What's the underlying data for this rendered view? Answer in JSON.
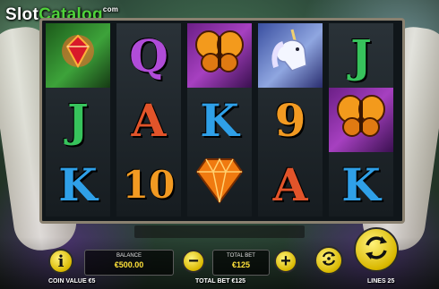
{
  "logo": {
    "part1": "Slot",
    "part2": "Catalog",
    "suffix": "com"
  },
  "reels": [
    [
      {
        "symbol": "",
        "kind": "wild",
        "icon": "red-gem-flower-icon"
      },
      {
        "symbol": "J",
        "kind": "letter",
        "color": "green"
      },
      {
        "symbol": "K",
        "kind": "letter",
        "color": "blue"
      }
    ],
    [
      {
        "symbol": "Q",
        "kind": "letter",
        "color": "purple"
      },
      {
        "symbol": "A",
        "kind": "letter",
        "color": "red"
      },
      {
        "symbol": "10",
        "kind": "letter",
        "color": "orange"
      }
    ],
    [
      {
        "symbol": "",
        "kind": "picture",
        "icon": "butterfly-icon"
      },
      {
        "symbol": "K",
        "kind": "letter",
        "color": "blue"
      },
      {
        "symbol": "",
        "kind": "picture",
        "icon": "orange-diamond-icon"
      }
    ],
    [
      {
        "symbol": "",
        "kind": "picture",
        "icon": "unicorn-icon"
      },
      {
        "symbol": "9",
        "kind": "letter",
        "color": "orange"
      },
      {
        "symbol": "A",
        "kind": "letter",
        "color": "red"
      }
    ],
    [
      {
        "symbol": "J",
        "kind": "letter",
        "color": "green"
      },
      {
        "symbol": "",
        "kind": "picture",
        "icon": "butterfly-icon"
      },
      {
        "symbol": "K",
        "kind": "letter",
        "color": "blue"
      }
    ]
  ],
  "controls": {
    "info_label": "i",
    "balance_label": "BALANCE",
    "balance_value": "€500.00",
    "minus_label": "−",
    "total_bet_label": "TOTAL BET",
    "total_bet_value": "€125",
    "plus_label": "+",
    "autoplay_icon": "autoplay-icon",
    "spin_icon": "spin-icon"
  },
  "footer": {
    "coin_value": "COIN VALUE €5",
    "total_bet": "TOTAL BET €125",
    "lines": "LINES 25"
  },
  "colors": {
    "accent_yellow": "#ffe23a",
    "button_yellow": "#d9b800",
    "logo_green": "#4fd23a"
  }
}
